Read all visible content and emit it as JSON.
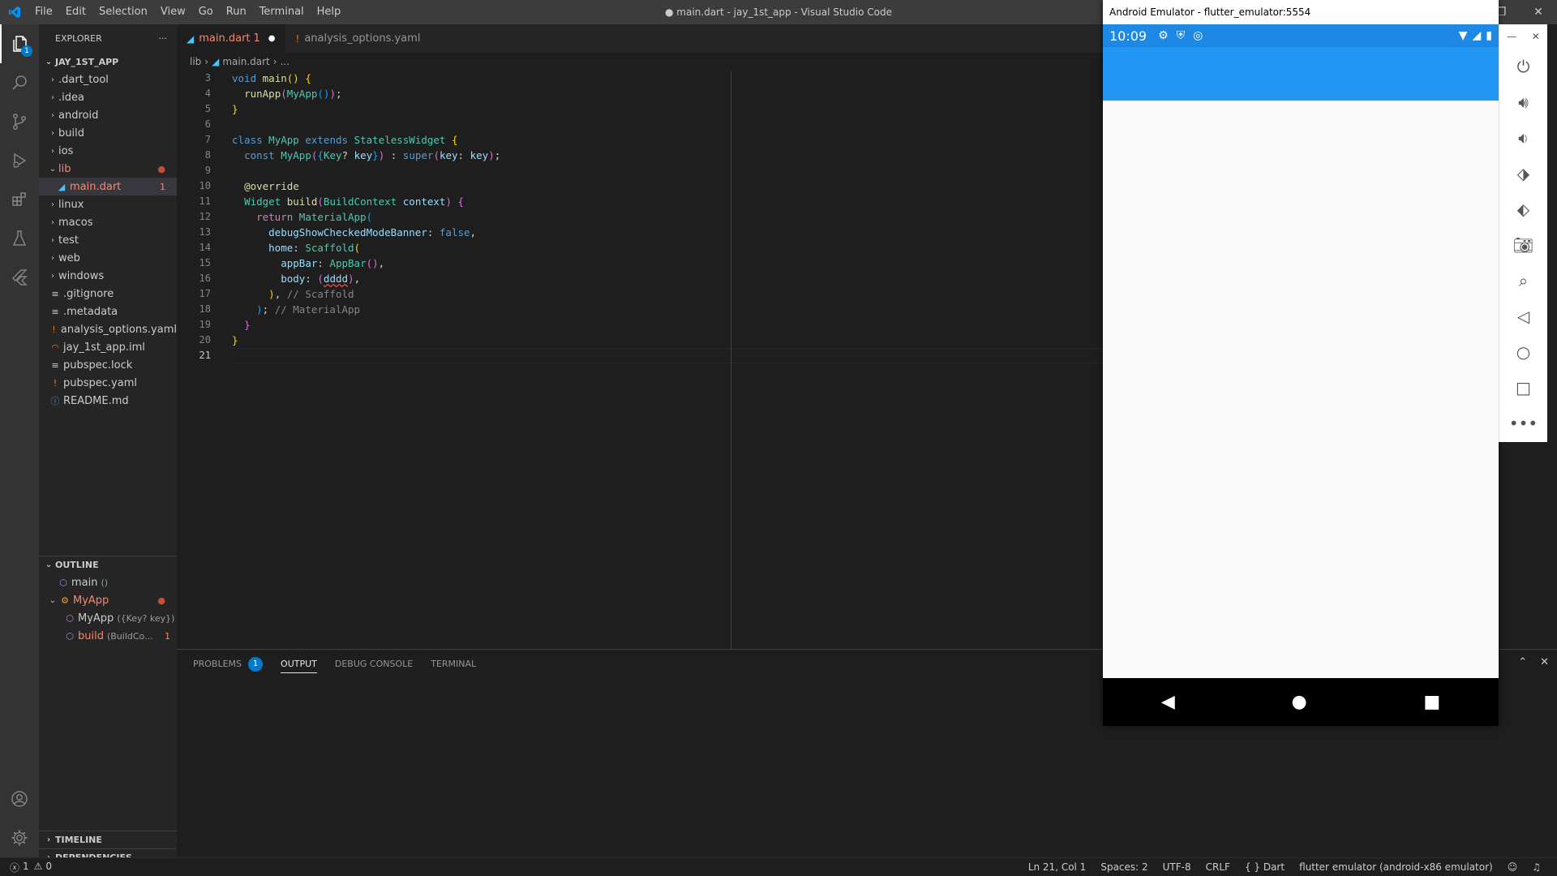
{
  "titlebar": {
    "menu": [
      "File",
      "Edit",
      "Selection",
      "View",
      "Go",
      "Run",
      "Terminal",
      "Help"
    ],
    "title": "● main.dart - jay_1st_app - Visual Studio Code"
  },
  "activity": {
    "explorer_badge": "1"
  },
  "explorer": {
    "header": "EXPLORER",
    "more": "···",
    "project": "JAY_1ST_APP",
    "items": [
      {
        "label": ".dart_tool",
        "type": "folder"
      },
      {
        "label": ".idea",
        "type": "folder"
      },
      {
        "label": "android",
        "type": "folder"
      },
      {
        "label": "build",
        "type": "folder"
      },
      {
        "label": "ios",
        "type": "folder"
      },
      {
        "label": "lib",
        "type": "folder-open"
      },
      {
        "label": "main.dart",
        "type": "dart"
      },
      {
        "label": "linux",
        "type": "folder"
      },
      {
        "label": "macos",
        "type": "folder"
      },
      {
        "label": "test",
        "type": "folder"
      },
      {
        "label": "web",
        "type": "folder"
      },
      {
        "label": "windows",
        "type": "folder"
      },
      {
        "label": ".gitignore",
        "type": "file"
      },
      {
        "label": ".metadata",
        "type": "file"
      },
      {
        "label": "analysis_options.yaml",
        "type": "yaml"
      },
      {
        "label": "jay_1st_app.iml",
        "type": "rss"
      },
      {
        "label": "pubspec.lock",
        "type": "file"
      },
      {
        "label": "pubspec.yaml",
        "type": "yaml"
      },
      {
        "label": "README.md",
        "type": "info"
      }
    ],
    "main_dart_count": "1"
  },
  "outline": {
    "header": "OUTLINE",
    "items": [
      {
        "label": "main",
        "detail": "()"
      },
      {
        "label": "MyApp",
        "detail": ""
      },
      {
        "label": "MyApp",
        "detail": "({Key? key})"
      },
      {
        "label": "build",
        "detail": "(BuildCo...",
        "count": "1"
      }
    ]
  },
  "timeline": "TIMELINE",
  "dependencies": "DEPENDENCIES",
  "tabs": [
    {
      "label": "main.dart",
      "suffix": "1"
    },
    {
      "label": "analysis_options.yaml"
    }
  ],
  "breadcrumb": {
    "folder": "lib",
    "file": "main.dart",
    "rest": "..."
  },
  "editor": {
    "line_numbers": [
      "3",
      "4",
      "5",
      "6",
      "7",
      "8",
      "9",
      "10",
      "11",
      "12",
      "13",
      "14",
      "15",
      "16",
      "17",
      "18",
      "19",
      "20",
      "21"
    ],
    "current_line": "21"
  },
  "panel": {
    "tabs": [
      "PROBLEMS",
      "OUTPUT",
      "DEBUG CONSOLE",
      "TERMINAL"
    ],
    "problems_count": "1"
  },
  "status": {
    "errors": "1",
    "warnings": "0",
    "position": "Ln 21, Col 1",
    "spaces": "Spaces: 2",
    "encoding": "UTF-8",
    "eol": "CRLF",
    "language": "{ } Dart",
    "device": "flutter emulator (android-x86 emulator)"
  },
  "emulator": {
    "title": "Android Emulator - flutter_emulator:5554",
    "time": "10:09",
    "appbar_color": "#2196f3",
    "statusbar_color": "#1e88e5"
  }
}
